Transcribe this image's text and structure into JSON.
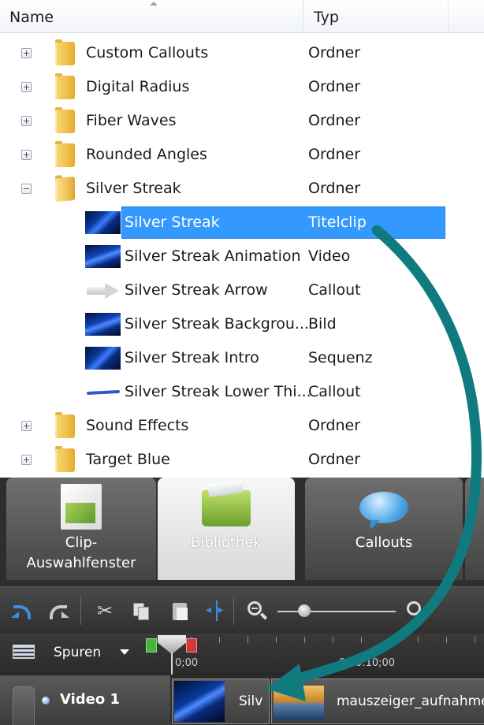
{
  "library": {
    "columns": {
      "name": "Name",
      "type": "Typ"
    },
    "rows": [
      {
        "label": "Custom Callouts",
        "type": "Ordner"
      },
      {
        "label": "Digital Radius",
        "type": "Ordner"
      },
      {
        "label": "Fiber Waves",
        "type": "Ordner"
      },
      {
        "label": "Rounded Angles",
        "type": "Ordner"
      },
      {
        "label": "Silver Streak",
        "type": "Ordner",
        "expanded": true
      },
      {
        "label": "Silver Streak",
        "type": "Titelclip",
        "selected": true
      },
      {
        "label": "Silver Streak Animation",
        "type": "Video"
      },
      {
        "label": "Silver Streak Arrow",
        "type": "Callout"
      },
      {
        "label": "Silver Streak Backgrou...",
        "type": "Bild"
      },
      {
        "label": "Silver Streak Intro",
        "type": "Sequenz"
      },
      {
        "label": "Silver Streak Lower Thi...",
        "type": "Callout"
      },
      {
        "label": "Sound Effects",
        "type": "Ordner"
      },
      {
        "label": "Target Blue",
        "type": "Ordner"
      }
    ]
  },
  "tabs": {
    "clip": "Clip-\nAuswahlfenster",
    "clip_line1": "Clip-",
    "clip_line2": "Auswahlfenster",
    "library": "Bibliothek",
    "callouts": "Callouts",
    "active": "Bibliothek"
  },
  "toolbar": {
    "icons": [
      "undo-icon",
      "redo-icon",
      "cut-icon",
      "copy-icon",
      "paste-icon",
      "split-icon",
      "zoom-out-icon",
      "zoom-in-icon"
    ]
  },
  "timeline": {
    "tracks_label": "Spuren",
    "times": [
      "0;00",
      "0:00:10;00"
    ]
  },
  "track": {
    "name": "Video 1",
    "clips": [
      {
        "label": "Silv"
      },
      {
        "label": "mauszeiger_aufnahme"
      }
    ]
  },
  "colors": {
    "selection": "#3399ff",
    "annotation_arrow": "#0f7b7e",
    "panel_dark": "#2e2e2e"
  }
}
